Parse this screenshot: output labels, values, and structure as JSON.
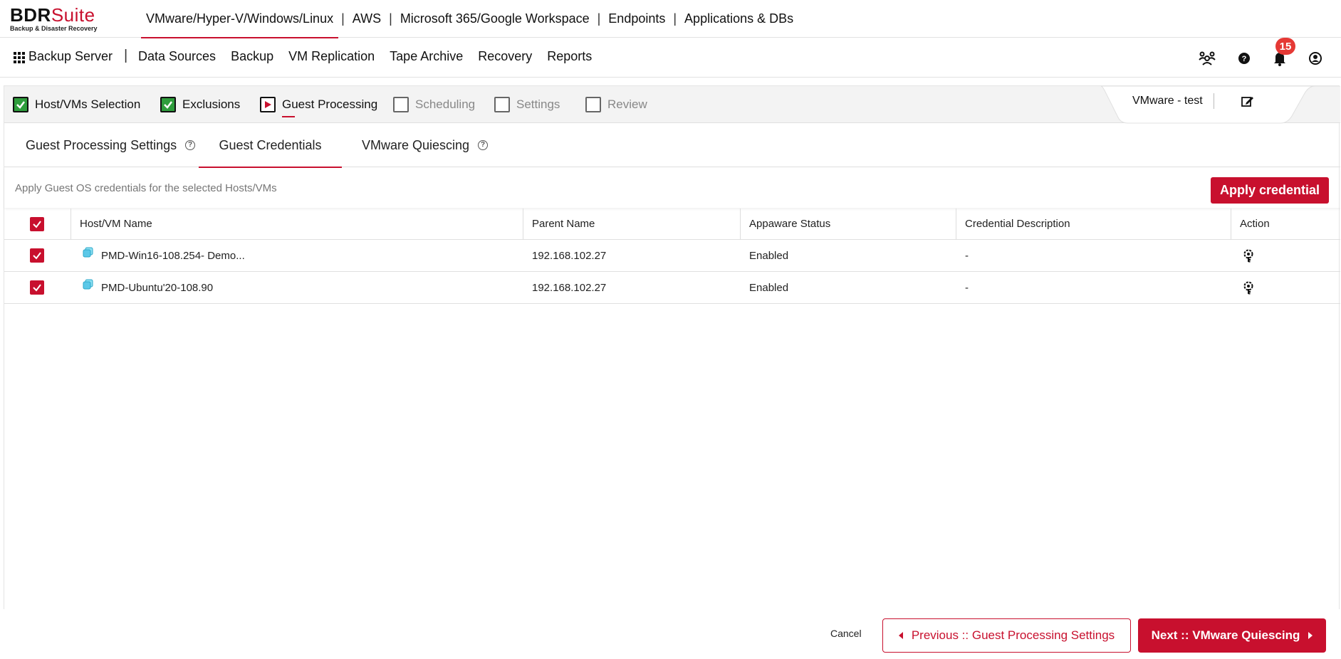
{
  "brand": {
    "name_part1": "BDR",
    "name_part2": "Suite",
    "tagline": "Backup & Disaster Recovery"
  },
  "products": [
    {
      "label": "VMware/Hyper-V/Windows/Linux",
      "active": true
    },
    {
      "label": "AWS"
    },
    {
      "label": "Microsoft 365/Google Workspace"
    },
    {
      "label": "Endpoints"
    },
    {
      "label": "Applications & DBs"
    }
  ],
  "product_separator": "|",
  "nav": {
    "server_label": "Backup Server",
    "separator": "|",
    "links": [
      "Data Sources",
      "Backup",
      "VM Replication",
      "Tape Archive",
      "Recovery",
      "Reports"
    ],
    "notification_count": "15",
    "icons": [
      "community-icon",
      "help-icon",
      "bell-icon",
      "user-icon"
    ]
  },
  "steps": [
    {
      "label": "Host/VMs Selection",
      "state": "done"
    },
    {
      "label": "Exclusions",
      "state": "done"
    },
    {
      "label": "Guest Processing",
      "state": "current"
    },
    {
      "label": "Scheduling",
      "state": "pending"
    },
    {
      "label": "Settings",
      "state": "pending"
    },
    {
      "label": "Review",
      "state": "pending"
    }
  ],
  "job": {
    "name": "VMware - test"
  },
  "subtabs": [
    {
      "label": "Guest Processing Settings",
      "help": "?"
    },
    {
      "label": "Guest Credentials",
      "active": true
    },
    {
      "label": "VMware Quiescing",
      "help": "?"
    }
  ],
  "info": {
    "text": "Apply Guest OS credentials for the selected Hosts/VMs",
    "apply_button": "Apply credential"
  },
  "table": {
    "columns": [
      "Host/VM Name",
      "Parent Name",
      "Appaware Status",
      "Credential Description",
      "Action"
    ],
    "rows": [
      {
        "name": "PMD-Win16-108.254- Demo...",
        "parent": "192.168.102.27",
        "status": "Enabled",
        "description": "-"
      },
      {
        "name": "PMD-Ubuntu'20-108.90",
        "parent": "192.168.102.27",
        "status": "Enabled",
        "description": "-"
      }
    ]
  },
  "footer": {
    "cancel": "Cancel",
    "previous": "Previous :: Guest Processing Settings",
    "next": "Next :: VMware Quiescing"
  },
  "colors": {
    "accent": "#c8102e",
    "done_green": "#2e9d3c",
    "badge": "#e53935"
  }
}
